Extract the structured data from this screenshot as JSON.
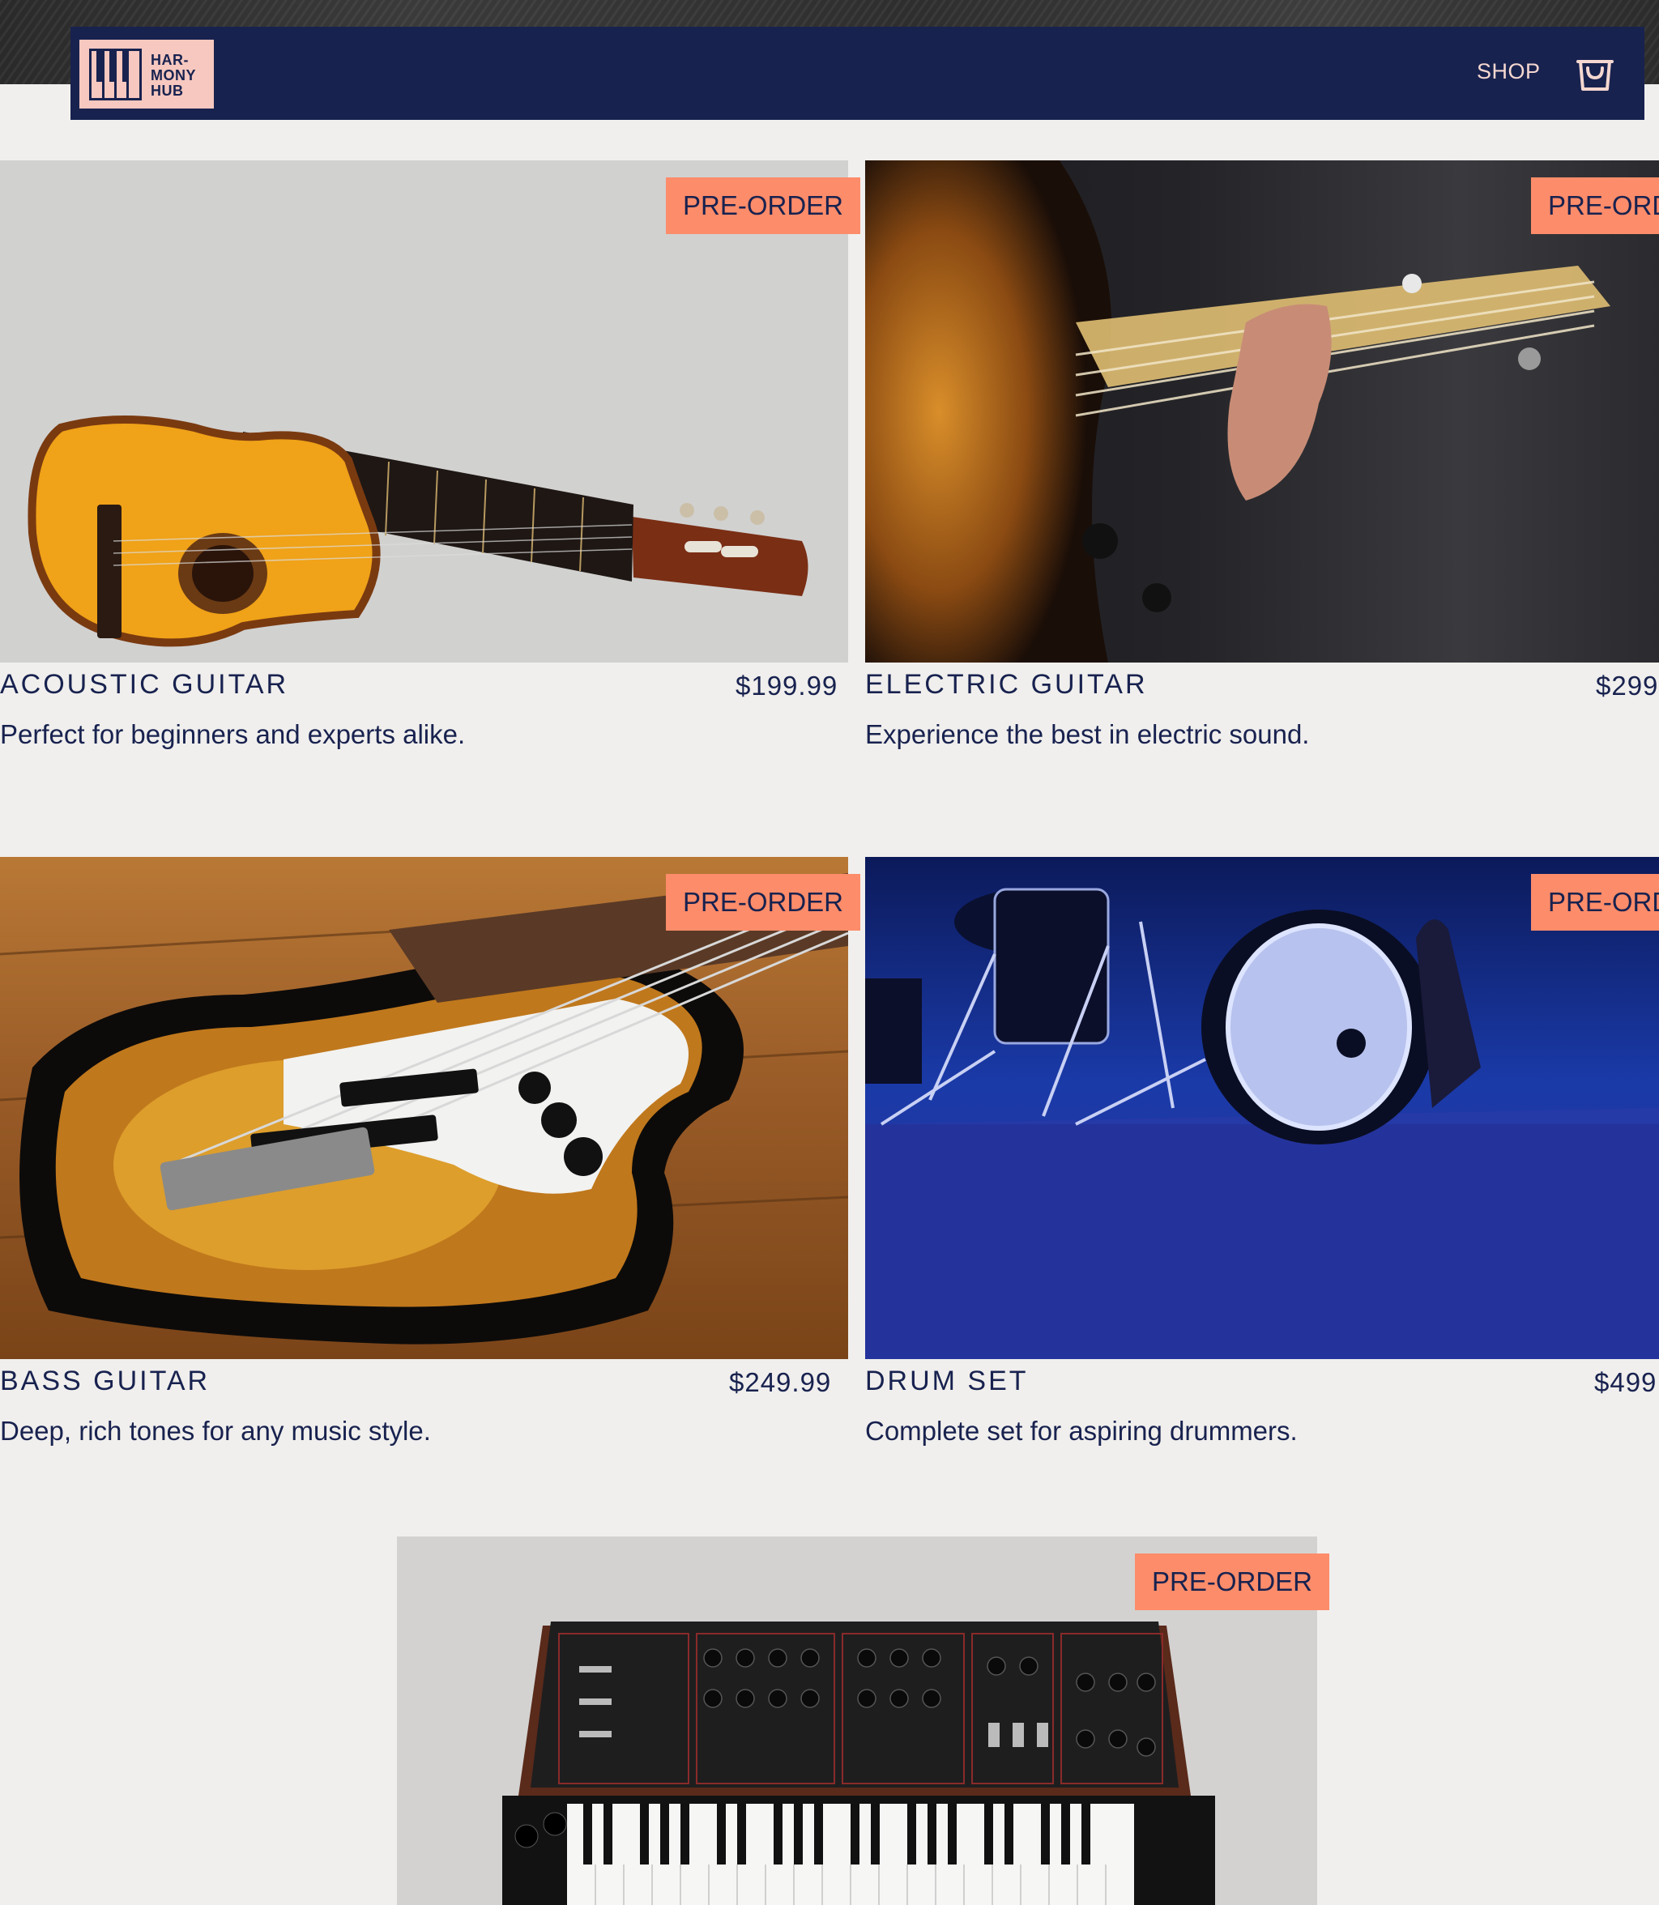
{
  "brand": {
    "logo_text": "HAR-\nMONY\nHUB",
    "colors": {
      "navy": "#18224f",
      "accent": "#fd8c6a",
      "logo_bg": "#f6c8bf",
      "page_bg": "#f0efed"
    }
  },
  "nav": {
    "shop_label": "SHOP",
    "cart_icon": "shopping-bag-icon"
  },
  "products": [
    {
      "title": "ACOUSTIC GUITAR",
      "price": "$199.99",
      "description": "Perfect for beginners and experts alike.",
      "badge": "PRE-ORDER",
      "image": "acoustic-guitar"
    },
    {
      "title": "ELECTRIC GUITAR",
      "price": "$299",
      "description": "Experience the best in electric sound.",
      "badge": "PRE-ORD",
      "image": "electric-guitar"
    },
    {
      "title": "BASS GUITAR",
      "price": "$249.99",
      "description": "Deep, rich tones for any music style.",
      "badge": "PRE-ORDER",
      "image": "bass-guitar"
    },
    {
      "title": "DRUM SET",
      "price": "$499",
      "description": "Complete set for aspiring drummers.",
      "badge": "PRE-ORD",
      "image": "drum-set"
    },
    {
      "title": "",
      "price": "",
      "description": "",
      "badge": "PRE-ORDER",
      "image": "synthesizer"
    }
  ]
}
